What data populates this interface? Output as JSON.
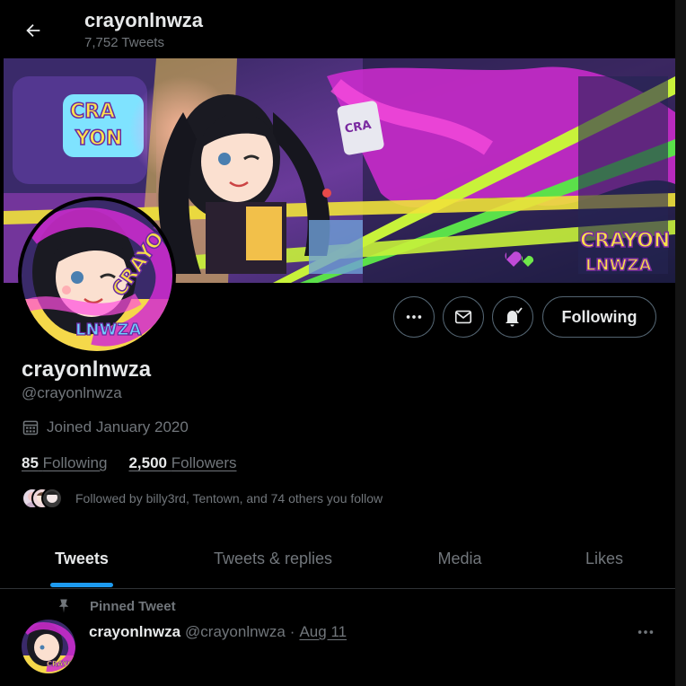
{
  "header": {
    "title": "crayonlnwza",
    "tweet_count": "7,752 Tweets"
  },
  "banner": {
    "description_icons": [
      "heart-icon"
    ]
  },
  "profile": {
    "display_name": "crayonlnwza",
    "handle": "@crayonlnwza",
    "joined": "Joined January 2020",
    "following_count": "85",
    "following_label": "Following",
    "followers_count": "2,500",
    "followers_label": "Followers",
    "followed_by": "Followed by billy3rd, Tentown, and 74 others you follow"
  },
  "actions": {
    "more_icon": "more-horizontal-icon",
    "message_icon": "envelope-icon",
    "notify_icon": "bell-check-icon",
    "follow_button": "Following"
  },
  "tabs": [
    {
      "label": "Tweets",
      "active": true
    },
    {
      "label": "Tweets & replies",
      "active": false
    },
    {
      "label": "Media",
      "active": false
    },
    {
      "label": "Likes",
      "active": false
    }
  ],
  "pinned_tweet": {
    "label": "Pinned Tweet",
    "name": "crayonlnwza",
    "handle": "@crayonlnwza",
    "separator": "·",
    "date": "Aug 11"
  },
  "colors": {
    "accent": "#1d9bf0",
    "background": "#000000",
    "secondary_text": "#71767b"
  }
}
